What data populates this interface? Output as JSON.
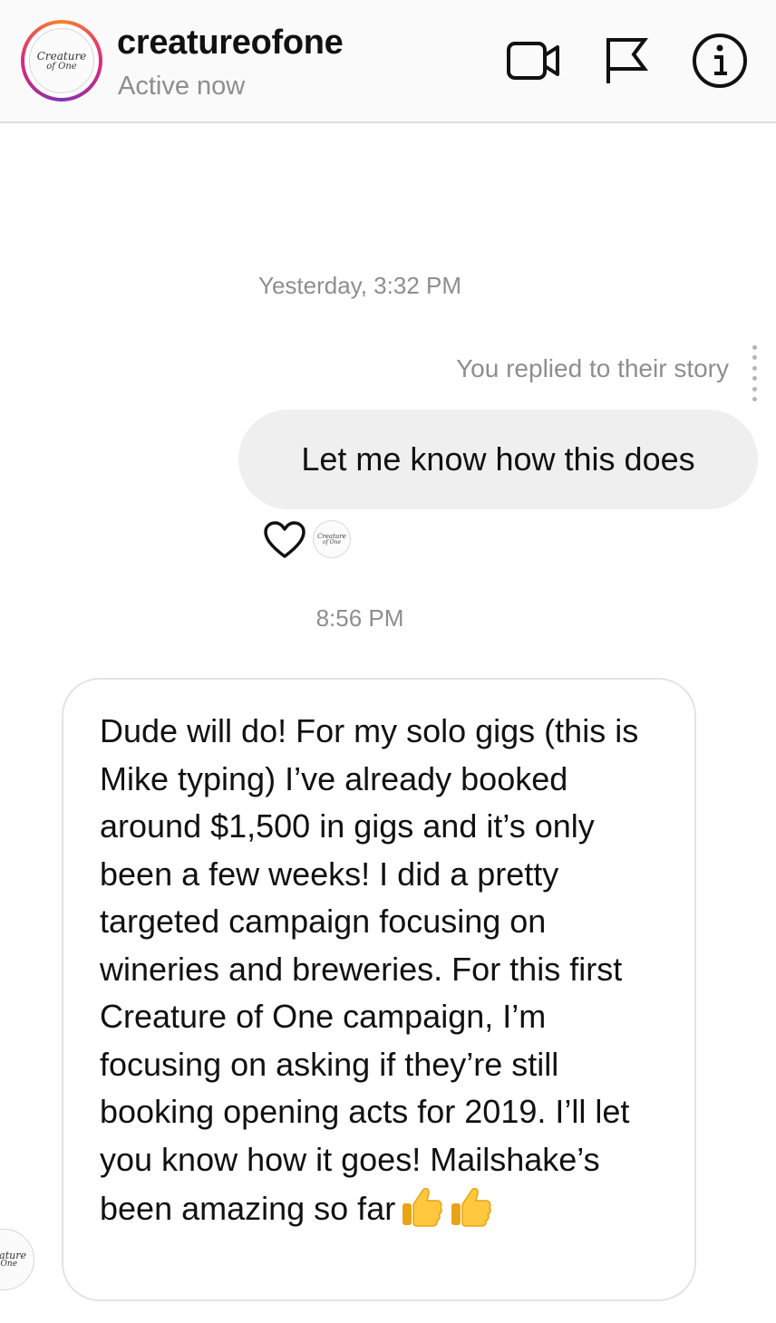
{
  "header": {
    "username": "creatureofone",
    "status": "Active now",
    "avatar_text_line1": "Creature",
    "avatar_text_line2": "of One",
    "icons": [
      "video-call-icon",
      "flag-icon",
      "info-icon"
    ]
  },
  "thread": {
    "timestamp_1": "Yesterday, 3:32 PM",
    "reply_note": "You replied to their story",
    "sent_message": "Let me know how this does",
    "reaction_icon": "heart-icon",
    "timestamp_2": "8:56 PM",
    "received_message": "Dude will do! For my solo gigs (this is Mike typing) I’ve already booked around $1,500 in gigs and it’s only been a few weeks! I did a pretty targeted campaign focusing on wineries and breweries. For this first Creature of One campaign, I’m focusing on asking if they’re still booking opening acts for 2019. I’ll let you know how it goes! Mailshake’s been amazing so far",
    "received_emoji": [
      "thumbs-up-icon",
      "thumbs-up-icon"
    ]
  },
  "colors": {
    "header_bg": "#fafafa",
    "secondary_text": "#8e8e8e",
    "sent_bubble": "#efefef",
    "bubble_border": "#e3e3e3",
    "ring_gradient": [
      "#f58529",
      "#dd2a7b",
      "#8134af"
    ]
  }
}
